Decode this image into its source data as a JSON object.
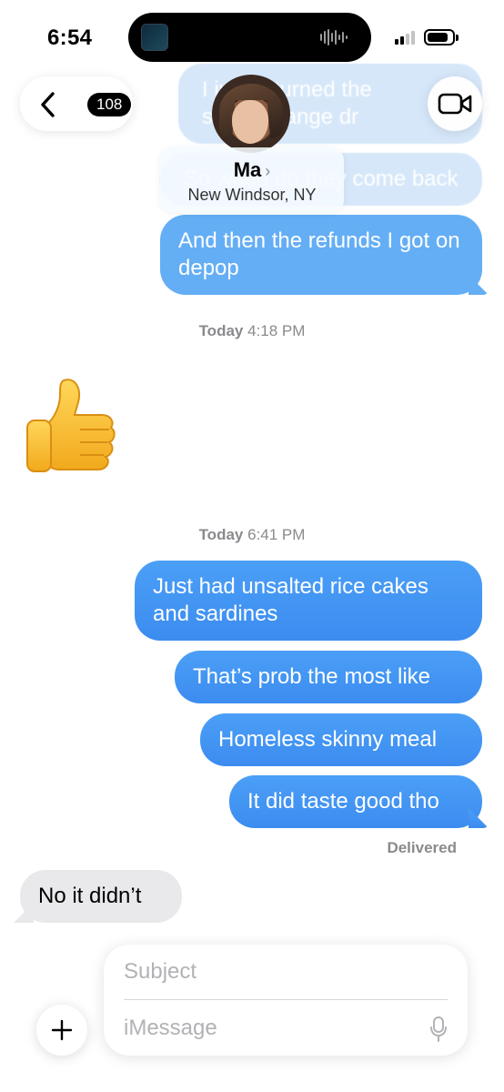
{
  "status_bar": {
    "time": "6:54"
  },
  "nav": {
    "back_count": "108",
    "contact_name": "Ma",
    "contact_location": "New Windsor, NY"
  },
  "ghost_messages": [
    "I just returned the",
    "s  own orange dr",
    "So when do they come back"
  ],
  "messages": {
    "m1": "And then the refunds I got on depop",
    "m2": "Just had unsalted rice cakes and sardines",
    "m3": "That’s prob the most like",
    "m4": "Homeless skinny meal",
    "m5": "It did taste good tho",
    "m6": "No it didn’t"
  },
  "timestamps": {
    "t1_day": "Today",
    "t1_time": "4:18 PM",
    "t2_day": "Today",
    "t2_time": "6:41 PM"
  },
  "reaction_emoji": "thumbs-up",
  "delivered_label": "Delivered",
  "composer": {
    "subject_placeholder": "Subject",
    "message_placeholder": "iMessage"
  },
  "colors": {
    "outgoing": "#3c8cf0",
    "incoming": "#e9e9eb",
    "timestamp": "#8a8a8e"
  }
}
